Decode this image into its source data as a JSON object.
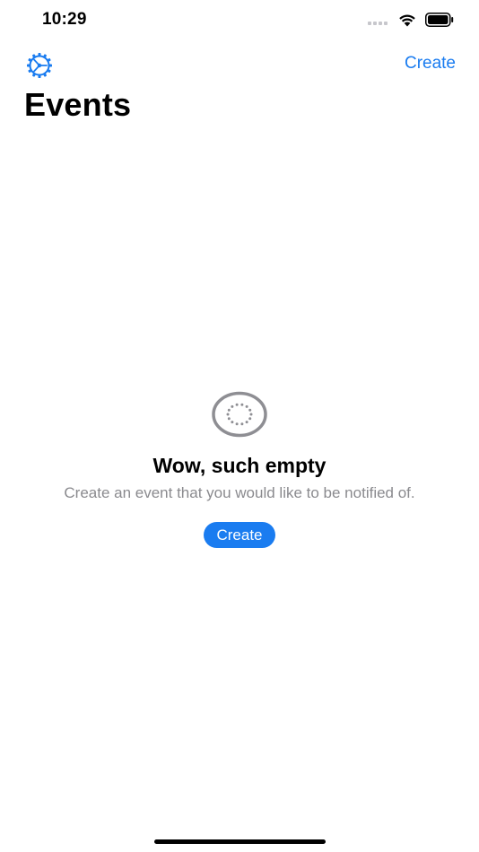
{
  "status_bar": {
    "time": "10:29",
    "icons": [
      "signal-icon",
      "wifi-icon",
      "battery-icon"
    ]
  },
  "nav": {
    "settings_icon": "gear-icon",
    "create_label": "Create"
  },
  "page": {
    "title": "Events"
  },
  "empty_state": {
    "icon": "empty-circle-icon",
    "title": "Wow, such empty",
    "subtitle": "Create an event that you would like to be notified of.",
    "button_label": "Create"
  },
  "colors": {
    "accent": "#1a7cf0",
    "secondary_text": "#8a8a8e",
    "icon_gray": "#8e8e93"
  }
}
